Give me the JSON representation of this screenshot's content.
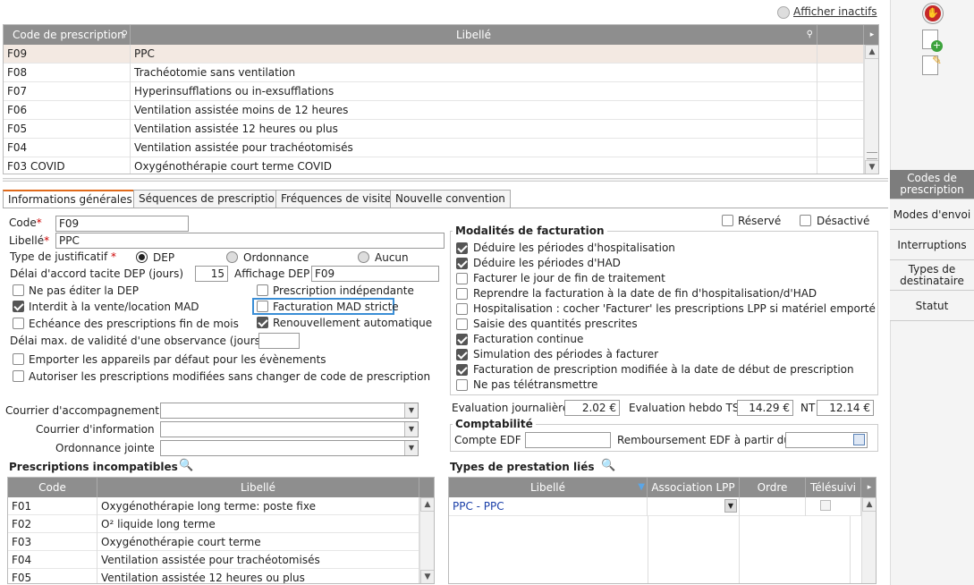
{
  "top_link": "Afficher inactifs",
  "main_grid": {
    "headers": [
      "Code de prescription",
      "Libellé"
    ],
    "rows": [
      {
        "code": "F09",
        "label": "PPC"
      },
      {
        "code": "F08",
        "label": "Trachéotomie sans ventilation"
      },
      {
        "code": "F07",
        "label": "Hyperinsufflations ou in-exsufflations"
      },
      {
        "code": "F06",
        "label": "Ventilation assistée moins de 12 heures"
      },
      {
        "code": "F05",
        "label": "Ventilation assistée 12 heures ou plus"
      },
      {
        "code": "F04",
        "label": "Ventilation assistée pour trachéotomisés"
      },
      {
        "code": "F03 COVID",
        "label": "Oxygénothérapie court terme COVID"
      }
    ]
  },
  "tabs": [
    "Informations générales",
    "Séquences de prescription",
    "Fréquences de visite",
    "Nouvelle convention"
  ],
  "form": {
    "code_label": "Code",
    "code_value": "F09",
    "libelle_label": "Libellé",
    "libelle_value": "PPC",
    "type_label": "Type de justificatif",
    "radio_dep": "DEP",
    "radio_ordonnance": "Ordonnance",
    "radio_aucun": "Aucun",
    "delai_label": "Délai d'accord tacite DEP (jours)",
    "delai_value": "15",
    "affichage_label": "Affichage DEP",
    "affichage_value": "F09",
    "cb_ne_pas_editer": "Ne pas éditer la DEP",
    "cb_prescription_indep": "Prescription indépendante",
    "cb_interdit": "Interdit à la vente/location MAD",
    "cb_facturation_mad": "Facturation MAD stricte",
    "cb_echeance": "Echéance des prescriptions fin de mois",
    "cb_renouvellement": "Renouvellement automatique",
    "delai_max_label": "Délai max. de validité d'une observance (jours)",
    "cb_emporter": "Emporter les appareils par défaut pour les évènements",
    "cb_autoriser": "Autoriser les prescriptions modifiées sans changer de code de prescription",
    "courrier_accomp": "Courrier d'accompagnement",
    "courrier_info": "Courrier d'information",
    "ordonnance_jointe": "Ordonnance jointe"
  },
  "reserve_label": "Réservé",
  "desactive_label": "Désactivé",
  "modalites": {
    "legend": "Modalités de facturation",
    "items": [
      {
        "label": "Déduire les périodes d'hospitalisation",
        "checked": true
      },
      {
        "label": "Déduire les périodes d'HAD",
        "checked": true
      },
      {
        "label": "Facturer le jour de fin de traitement",
        "checked": false
      },
      {
        "label": "Reprendre la facturation à la date de fin d'hospitalisation/d'HAD",
        "checked": false
      },
      {
        "label": "Hospitalisation : cocher 'Facturer' les prescriptions LPP si matériel emporté",
        "checked": false
      },
      {
        "label": "Saisie des quantités prescrites",
        "checked": false
      },
      {
        "label": "Facturation continue",
        "checked": true
      },
      {
        "label": "Simulation des périodes à facturer",
        "checked": true
      },
      {
        "label": "Facturation de prescription modifiée à la date de début de prescription",
        "checked": true
      },
      {
        "label": "Ne pas télétransmettre",
        "checked": false
      }
    ]
  },
  "evaluation": {
    "journaliere_label": "Evaluation journalière",
    "journaliere_value": "2.02 €",
    "hebdo_label": "Evaluation hebdo TS",
    "hebdo_value": "14.29 €",
    "nt_label": "NT",
    "nt_value": "12.14 €"
  },
  "comptabilite": {
    "legend": "Comptabilité",
    "compte_label": "Compte EDF",
    "rembourse_label": "Remboursement EDF à partir du"
  },
  "incompatibles": {
    "title": "Prescriptions incompatibles",
    "headers": [
      "Code",
      "Libellé"
    ],
    "rows": [
      {
        "code": "F01",
        "label": "Oxygénothérapie long terme: poste fixe"
      },
      {
        "code": "F02",
        "label": "O² liquide long terme"
      },
      {
        "code": "F03",
        "label": "Oxygénothérapie court terme"
      },
      {
        "code": "F04",
        "label": "Ventilation assistée pour trachéotomisés"
      },
      {
        "code": "F05",
        "label": "Ventilation assistée 12 heures ou plus"
      }
    ]
  },
  "prestations": {
    "title": "Types de prestation liés",
    "headers": [
      "Libellé",
      "Association LPP",
      "Ordre",
      "Télésuivi"
    ],
    "rows": [
      {
        "label": "PPC - PPC"
      }
    ]
  },
  "sidebar": {
    "items": [
      "Codes de prescription",
      "Modes d'envoi",
      "Interruptions",
      "Types de destinataire",
      "Statut"
    ]
  }
}
